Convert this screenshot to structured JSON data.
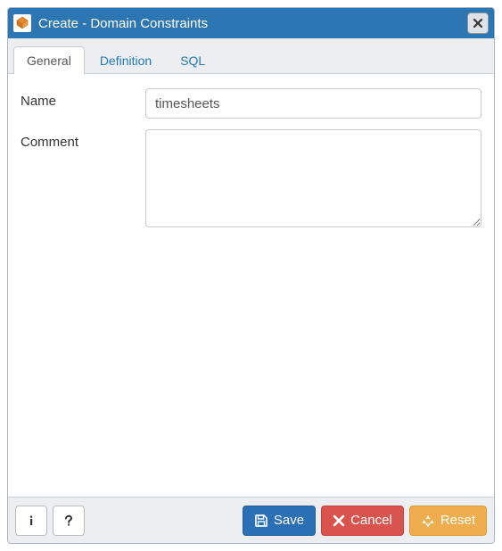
{
  "dialog": {
    "title": "Create - Domain Constraints"
  },
  "tabs": {
    "general": "General",
    "definition": "Definition",
    "sql": "SQL",
    "active": "general"
  },
  "form": {
    "name_label": "Name",
    "name_value": "timesheets",
    "comment_label": "Comment",
    "comment_value": ""
  },
  "footer": {
    "info_title": "Info",
    "help_title": "Help",
    "save_label": "Save",
    "cancel_label": "Cancel",
    "reset_label": "Reset"
  },
  "colors": {
    "header": "#2c76b4",
    "primary": "#2b6fb4",
    "danger": "#d9534f",
    "warning": "#f0ad4e"
  }
}
